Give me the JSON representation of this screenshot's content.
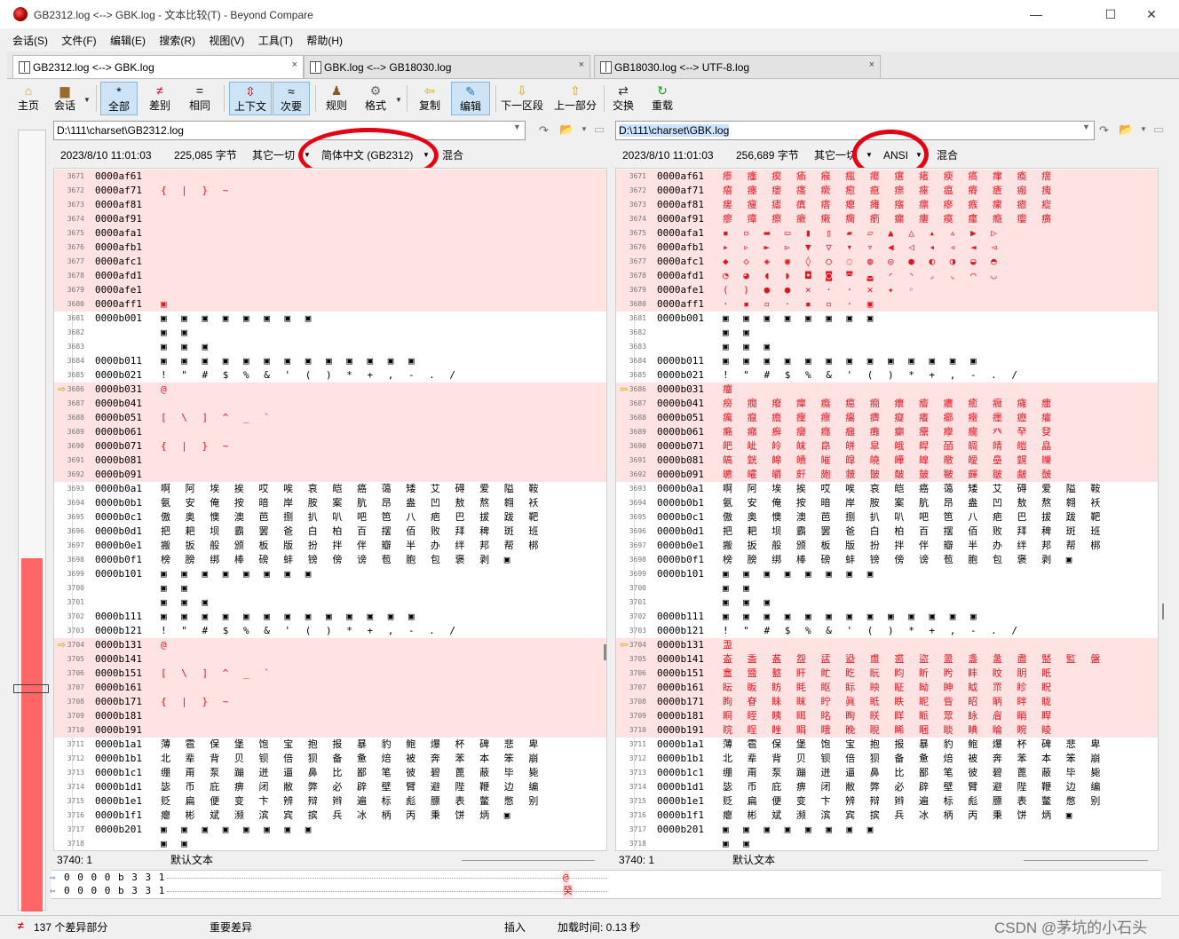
{
  "window": {
    "title": "GB2312.log <--> GBK.log - 文本比较(T) - Beyond Compare",
    "minimize": "—",
    "maximize": "☐",
    "close": "✕"
  },
  "menu": [
    "会话(S)",
    "文件(F)",
    "编辑(E)",
    "搜索(R)",
    "视图(V)",
    "工具(T)",
    "帮助(H)"
  ],
  "tabs": [
    {
      "label": "GB2312.log <--> GBK.log",
      "close": "×"
    },
    {
      "label": "GBK.log <--> GB18030.log",
      "close": "×"
    },
    {
      "label": "GB18030.log <--> UTF-8.log",
      "close": "×"
    }
  ],
  "toolbar": {
    "home": "主页",
    "session": "会话",
    "all": "全部",
    "diffs": "差别",
    "same": "相同",
    "context": "上下文",
    "minor": "次要",
    "rules": "规则",
    "format": "格式",
    "copy": "复制",
    "edit": "编辑",
    "next": "下一区段",
    "prev": "上一部分",
    "swap": "交换",
    "reload": "重载"
  },
  "left": {
    "path": "D:\\111\\charset\\GB2312.log",
    "date": "2023/8/10 11:01:03",
    "size": "225,085 字节",
    "other": "其它一切",
    "encoding": "简体中文 (GB2312)",
    "mixed": "混合",
    "status_pos": "3740: 1",
    "status_text": "默认文本"
  },
  "right": {
    "path": "D:\\111\\charset\\GBK.log",
    "date": "2023/8/10 11:01:03",
    "size": "256,689 字节",
    "other": "其它一切",
    "encoding": "ANSI",
    "mixed": "混合",
    "status_pos": "3740: 1",
    "status_text": "默认文本"
  },
  "rows": [
    {
      "n": "3671",
      "a": "0000af61",
      "l": "",
      "r": "瘆 瘇 瘈 瘉 瘊 瘋 瘍 瘎 瘏 瘐 瘑 瘒 瘓 瘔",
      "d": true
    },
    {
      "n": "3672",
      "a": "0000af71",
      "l": "{ | } ~",
      "r": "瘖 瘗 瘘 瘙 瘚 瘛 瘜 瘝 瘞 瘟 瘠 瘡 瘢 瘣",
      "d": true
    },
    {
      "n": "3673",
      "a": "0000af81",
      "l": "",
      "r": "瘥 瘦 瘧 瘨 瘩 瘪 瘫 瘬 瘭 瘮 瘯 瘰 瘱 瘲",
      "d": true
    },
    {
      "n": "3674",
      "a": "0000af91",
      "l": "",
      "r": "瘳 瘴 瘵 瘶 瘷 瘸 瘹 瘺 瘻 瘼 瘽 瘾 瘿 癀",
      "d": true
    },
    {
      "n": "3675",
      "a": "0000afa1",
      "l": "",
      "r": "▪ ▫ ▬ ▭ ▮ ▯ ▰ ▱ ▲ △ ▴ ▵ ▶ ▷",
      "d": true
    },
    {
      "n": "3676",
      "a": "0000afb1",
      "l": "",
      "r": "▸ ▹ ► ▻ ▼ ▽ ▾ ▿ ◀ ◁ ◂ ◃ ◄ ◅",
      "d": true
    },
    {
      "n": "3677",
      "a": "0000afc1",
      "l": "",
      "r": "◆ ◇ ◈ ◉ ◊ ○ ◌ ◍ ◎ ● ◐ ◑ ◒ ◓",
      "d": true
    },
    {
      "n": "3678",
      "a": "0000afd1",
      "l": "",
      "r": "◔ ◕ ◖ ◗ ◘ ◙ ◚ ◛ ◜ ◝ ◞ ◟ ◠ ◡",
      "d": true
    },
    {
      "n": "3679",
      "a": "0000afe1",
      "l": "",
      "r": "( ) ● ● × · · ✕ ✦ ◦",
      "d": true
    },
    {
      "n": "3680",
      "a": "0000aff1",
      "l": "▣",
      "r": "· ▪ ▫ · ▪ ▫ · ▣",
      "d": true
    },
    {
      "n": "3681",
      "a": "0000b001",
      "l": "▣ ▣ ▣ ▣ ▣ ▣ ▣ ▣",
      "r": "▣ ▣ ▣ ▣ ▣ ▣ ▣ ▣",
      "d": false
    },
    {
      "n": "3682",
      "a": "",
      "l": "▣ ▣",
      "r": "▣ ▣",
      "d": false
    },
    {
      "n": "3683",
      "a": "",
      "l": "▣ ▣ ▣",
      "r": "▣ ▣ ▣",
      "d": false
    },
    {
      "n": "3684",
      "a": "0000b011",
      "l": "▣ ▣ ▣ ▣ ▣ ▣ ▣ ▣ ▣ ▣ ▣ ▣ ▣",
      "r": "▣ ▣ ▣ ▣ ▣ ▣ ▣ ▣ ▣ ▣ ▣ ▣ ▣",
      "d": false
    },
    {
      "n": "3685",
      "a": "0000b021",
      "l": "! \" # $ % & ' ( ) * + , - . /",
      "r": "! \" # $ % & ' ( ) * + , - . /",
      "d": false
    },
    {
      "n": "3686",
      "a": "0000b031",
      "l": "@",
      "r": "癅",
      "d": true
    },
    {
      "n": "3687",
      "a": "0000b041",
      "l": "",
      "r": "癆 癇 癈 癉 癊 癋 癎 癏 癐 癑 癒 癓 癕 癗",
      "d": true
    },
    {
      "n": "3688",
      "a": "0000b051",
      "l": "[ \\ ] ^ _ `",
      "r": "癘 癙 癚 癛 癝 癟 癠 癡 癢 癤 癥 癦 癧 癨",
      "d": true
    },
    {
      "n": "3689",
      "a": "0000b061",
      "l": "",
      "r": "癩 癪 癬 癭 癮 癰 癱 癲 癳 癴 癵 癶 癷 癹",
      "d": true
    },
    {
      "n": "3690",
      "a": "0000b071",
      "l": "{ | } ~",
      "r": "皅 皉 皊 皌 皍 皏 皐 皒 皔 皕 皗 皘 皚 皛",
      "d": true
    },
    {
      "n": "3691",
      "a": "0000b081",
      "l": "",
      "r": "皜 皝 皞 皟 皠 皡 皢 皣 皥 皦 皧 皨 皩 皪",
      "d": true
    },
    {
      "n": "3692",
      "a": "0000b091",
      "l": "",
      "r": "皫 皬 皭 皯 皰 皳 皵 皶 皷 皸 皹 皺 皻 皼",
      "d": true
    },
    {
      "n": "3693",
      "a": "0000b0a1",
      "l": "啊 阿 埃 挨 哎 唉 哀 皑 癌 蔼 矮 艾 碍 爱 隘 鞍",
      "r": "啊 阿 埃 挨 哎 唉 哀 皑 癌 蔼 矮 艾 碍 爱 隘 鞍",
      "d": false
    },
    {
      "n": "3694",
      "a": "0000b0b1",
      "l": "氨 安 俺 按 暗 岸 胺 案 肮 昂 盎 凹 敖 熬 翱 袄",
      "r": "氨 安 俺 按 暗 岸 胺 案 肮 昂 盎 凹 敖 熬 翱 袄",
      "d": false
    },
    {
      "n": "3695",
      "a": "0000b0c1",
      "l": "傲 奥 懊 澳 芭 捌 扒 叭 吧 笆 八 疤 巴 拔 跋 靶",
      "r": "傲 奥 懊 澳 芭 捌 扒 叭 吧 笆 八 疤 巴 拔 跋 靶",
      "d": false
    },
    {
      "n": "3696",
      "a": "0000b0d1",
      "l": "把 耙 坝 霸 罢 爸 白 柏 百 摆 佰 败 拜 稗 斑 班",
      "r": "把 耙 坝 霸 罢 爸 白 柏 百 摆 佰 败 拜 稗 斑 班",
      "d": false
    },
    {
      "n": "3697",
      "a": "0000b0e1",
      "l": "搬 扳 般 颁 板 版 扮 拌 伴 瓣 半 办 绊 邦 帮 梆",
      "r": "搬 扳 般 颁 板 版 扮 拌 伴 瓣 半 办 绊 邦 帮 梆",
      "d": false
    },
    {
      "n": "3698",
      "a": "0000b0f1",
      "l": "榜 膀 绑 棒 磅 蚌 镑 傍 谤 苞 胞 包 褒 剥 ▣",
      "r": "榜 膀 绑 棒 磅 蚌 镑 傍 谤 苞 胞 包 褒 剥 ▣",
      "d": false
    },
    {
      "n": "3699",
      "a": "0000b101",
      "l": "▣ ▣ ▣ ▣ ▣ ▣ ▣ ▣",
      "r": "▣ ▣ ▣ ▣ ▣ ▣ ▣ ▣",
      "d": false
    },
    {
      "n": "3700",
      "a": "",
      "l": "▣ ▣",
      "r": "▣ ▣",
      "d": false
    },
    {
      "n": "3701",
      "a": "",
      "l": "▣ ▣ ▣",
      "r": "▣ ▣ ▣",
      "d": false
    },
    {
      "n": "3702",
      "a": "0000b111",
      "l": "▣ ▣ ▣ ▣ ▣ ▣ ▣ ▣ ▣ ▣ ▣ ▣ ▣",
      "r": "▣ ▣ ▣ ▣ ▣ ▣ ▣ ▣ ▣ ▣ ▣ ▣ ▣",
      "d": false
    },
    {
      "n": "3703",
      "a": "0000b121",
      "l": "! \" # $ % & ' ( ) * + , - . /",
      "r": "! \" # $ % & ' ( ) * + , - . /",
      "d": false
    },
    {
      "n": "3704",
      "a": "0000b131",
      "l": "@",
      "r": "盄",
      "d": true
    },
    {
      "n": "3705",
      "a": "0000b141",
      "l": "",
      "r": "盇 盉 盋 盌 盓 盕 盙 盚 盜 盝 盞 盠 盡 盢 監 盤",
      "d": true
    },
    {
      "n": "3706",
      "a": "0000b151",
      "l": "[ \\ ] ^ _ `",
      "r": "盫 盬 盭 盰 盳 盵 盶 盷 盺 盻 盽 盿 眀 眂",
      "d": true
    },
    {
      "n": "3707",
      "a": "0000b161",
      "l": "",
      "r": "眃 眅 眆 眊 眍 眎 眏 眐 眑 眒 眓 眔 眕 眖",
      "d": true
    },
    {
      "n": "3708",
      "a": "0000b171",
      "l": "{ | } ~",
      "r": "眗 眘 眛 眜 眝 眞 眡 眣 眤 眥 眧 眪 眫 眬",
      "d": true
    },
    {
      "n": "3709",
      "a": "0000b181",
      "l": "",
      "r": "眮 眰 眱 眲 眳 眴 眹 眻 眽 眾 眿 睂 睄 睅",
      "d": true
    },
    {
      "n": "3710",
      "a": "0000b191",
      "l": "",
      "r": "睆 睈 睉 睊 睋 睌 睍 睎 睏 睒 睓 睔 睕 睖",
      "d": true
    },
    {
      "n": "3711",
      "a": "0000b1a1",
      "l": "薄 雹 保 堡 饱 宝 抱 报 暴 豹 鲍 爆 杯 碑 悲 卑",
      "r": "薄 雹 保 堡 饱 宝 抱 报 暴 豹 鲍 爆 杯 碑 悲 卑",
      "d": false
    },
    {
      "n": "3712",
      "a": "0000b1b1",
      "l": "北 辈 背 贝 钡 倍 狈 备 惫 焙 被 奔 苯 本 笨 崩",
      "r": "北 辈 背 贝 钡 倍 狈 备 惫 焙 被 奔 苯 本 笨 崩",
      "d": false
    },
    {
      "n": "3713",
      "a": "0000b1c1",
      "l": "绷 甭 泵 蹦 迸 逼 鼻 比 鄙 笔 彼 碧 蓖 蔽 毕 毙",
      "r": "绷 甭 泵 蹦 迸 逼 鼻 比 鄙 笔 彼 碧 蓖 蔽 毕 毙",
      "d": false
    },
    {
      "n": "3714",
      "a": "0000b1d1",
      "l": "毖 币 庇 痹 闭 敝 弊 必 辟 壁 臂 避 陛 鞭 边 编",
      "r": "毖 币 庇 痹 闭 敝 弊 必 辟 壁 臂 避 陛 鞭 边 编",
      "d": false
    },
    {
      "n": "3715",
      "a": "0000b1e1",
      "l": "贬 扁 便 变 卞 辨 辩 辫 遍 标 彪 膘 表 鳖 憋 别",
      "r": "贬 扁 便 变 卞 辨 辩 辫 遍 标 彪 膘 表 鳖 憋 别",
      "d": false
    },
    {
      "n": "3716",
      "a": "0000b1f1",
      "l": "瘪 彬 斌 濒 滨 宾 摈 兵 冰 柄 丙 秉 饼 炳 ▣",
      "r": "瘪 彬 斌 濒 滨 宾 摈 兵 冰 柄 丙 秉 饼 炳 ▣",
      "d": false
    },
    {
      "n": "3717",
      "a": "0000b201",
      "l": "▣ ▣ ▣ ▣ ▣ ▣ ▣ ▣",
      "r": "▣ ▣ ▣ ▣ ▣ ▣ ▣ ▣",
      "d": false
    },
    {
      "n": "3718",
      "a": "",
      "l": "▣ ▣",
      "r": "▣ ▣",
      "d": false
    }
  ],
  "compare_lines": {
    "top": "0 0 0 0 b 3 3 1",
    "top_char": "@",
    "bottom": "0 0 0 0 b 3 3 1",
    "bottom_char": "癸"
  },
  "statusbar": {
    "diffs": "137 个差异部分",
    "important": "重要差异",
    "insert": "插入",
    "load": "加载时间: 0.13 秒",
    "watermark": "CSDN @茅坑的小石头"
  }
}
